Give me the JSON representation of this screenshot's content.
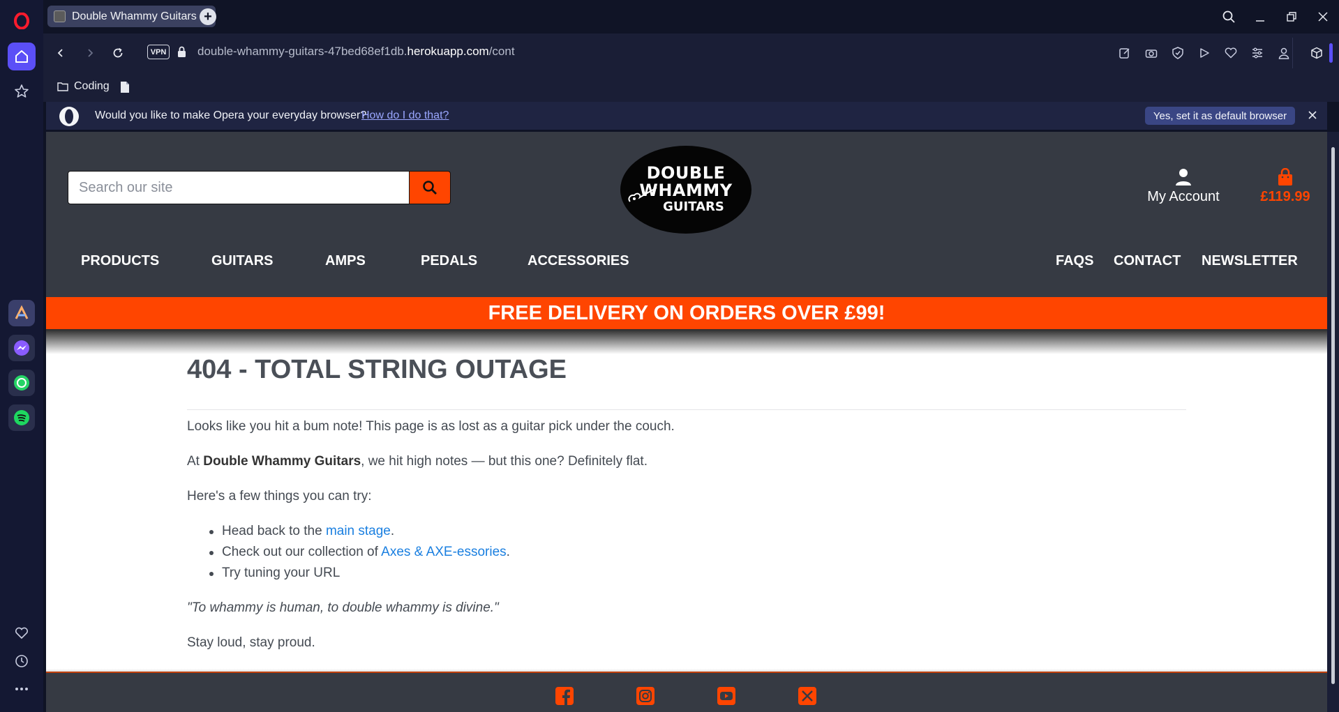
{
  "browser": {
    "tab_title": "Double Whammy Guitars",
    "new_tab": "+",
    "vpn_label": "VPN",
    "url_prefix": "double-whammy-guitars-47bed68ef1db.",
    "url_domain": "herokuapp.com",
    "url_path": "/cont",
    "bookmark_folder": "Coding",
    "prompt_text": "Would you like to make Opera your everyday browser?",
    "prompt_link": "How do I do that?",
    "prompt_button": "Yes, set it as default browser",
    "accent_color": "#5b4ff7"
  },
  "site": {
    "search_placeholder": "Search our site",
    "logo_line1": "DOUBLE",
    "logo_line2": "WHAMMY",
    "logo_line3": "GUITARS",
    "account_label": "My Account",
    "cart_total": "£119.99",
    "nav_left": [
      "PRODUCTS",
      "GUITARS",
      "AMPS",
      "PEDALS",
      "ACCESSORIES"
    ],
    "nav_right": [
      "FAQS",
      "CONTACT",
      "NEWSLETTER"
    ],
    "delivery_banner": "FREE DELIVERY ON ORDERS OVER £99!",
    "brand_color": "#ff4500",
    "header_color": "#363a43"
  },
  "content": {
    "heading": "404 - TOTAL STRING OUTAGE",
    "para1": "Looks like you hit a bum note! This page is as lost as a guitar pick under the couch.",
    "para2_pre": "At ",
    "para2_bold": "Double Whammy Guitars",
    "para2_post": ", we hit high notes — but this one? Definitely flat.",
    "para3": "Here's a few things you can try:",
    "bullet1_pre": "Head back to the ",
    "bullet1_link": "main stage",
    "bullet1_post": ".",
    "bullet2_pre": "Check out our collection of ",
    "bullet2_link": "Axes & AXE-essories",
    "bullet2_post": ".",
    "bullet3": "Try tuning your URL",
    "quote": "\"To whammy is human, to double whammy is divine.\"",
    "signoff": "Stay loud, stay proud."
  },
  "footer": {
    "icons": [
      "facebook-icon",
      "instagram-icon",
      "youtube-icon",
      "x-icon"
    ]
  }
}
